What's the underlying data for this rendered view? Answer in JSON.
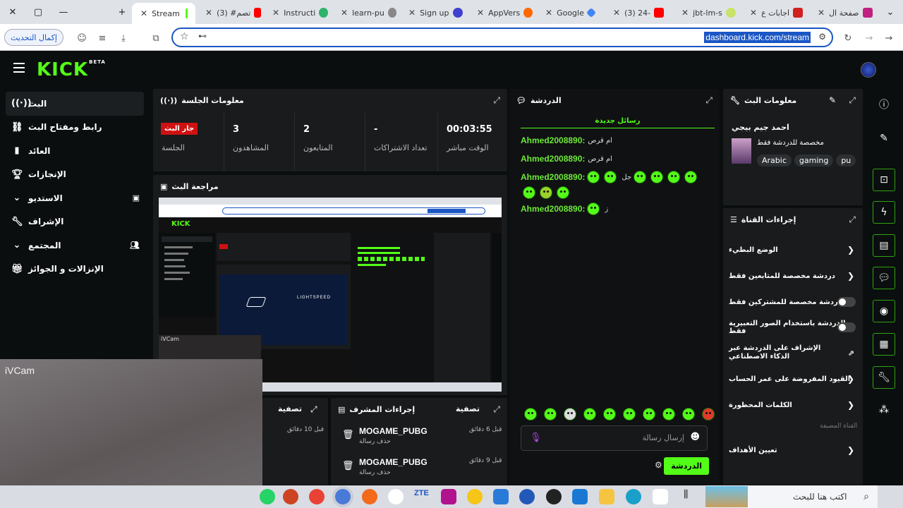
{
  "browser": {
    "window_controls": [
      "✕",
      "▢",
      "—"
    ],
    "tabs": [
      {
        "label": "Stream",
        "active": true,
        "color": "#53fc18"
      },
      {
        "label": "(3) #تصم",
        "color": "#ff0000"
      },
      {
        "label": "Instructi",
        "color": "#2fb36b"
      },
      {
        "label": "learn-pu",
        "color": "#888888"
      },
      {
        "label": "Sign up",
        "color": "#4040d0"
      },
      {
        "label": "AppVers",
        "color": "#ff6a00"
      },
      {
        "label": "Google",
        "color": "#4285f4"
      },
      {
        "label": "(3) 24-",
        "color": "#ff0000"
      },
      {
        "label": "jbt-lm-s",
        "color": "#c9e26a"
      },
      {
        "label": "اجابات ع",
        "color": "#d02020"
      },
      {
        "label": "صفحة ال",
        "color": "#c02080"
      }
    ],
    "url": "dashboard.kick.com/stream",
    "update_button": "إكمال التحديث"
  },
  "app": {
    "logo": "KICK",
    "logo_badge": "BETA",
    "sidebar": [
      {
        "label": "البث",
        "icon": "broadcast-icon",
        "active": true
      },
      {
        "label": "رابط ومفتاح البث",
        "icon": "link-icon"
      },
      {
        "label": "العائد",
        "icon": "chart-icon"
      },
      {
        "label": "الإنجازات",
        "icon": "trophy-icon"
      },
      {
        "label": "الاستديو",
        "icon": "studio-icon",
        "expandable": true
      },
      {
        "label": "الإشراف",
        "icon": "wrench-icon"
      },
      {
        "label": "المجتمع",
        "icon": "community-icon",
        "expandable": true
      },
      {
        "label": "الإنزالات و الجوائز",
        "icon": "gift-icon"
      }
    ],
    "session": {
      "title": "معلومات الجلسة",
      "live_badge": "جار البث",
      "stats": [
        {
          "value": "00:03:55",
          "label": "الوقت مباشر"
        },
        {
          "value": "-",
          "label": "تعداد الاشتراكات"
        },
        {
          "value": "2",
          "label": "المتابعون"
        },
        {
          "value": "3",
          "label": "المشاهدون"
        },
        {
          "value": "",
          "label": "الجلسة"
        }
      ]
    },
    "preview": {
      "title": "مراجعة البث"
    },
    "chat": {
      "title": "الدردشة",
      "new_messages": "رسائل جديدة",
      "messages": [
        {
          "user": "Ahmed2008890:",
          "text": "ام قرص",
          "emotes": 0
        },
        {
          "user": "Ahmed2008890:",
          "text": "ام قرص",
          "emotes": 0
        },
        {
          "user": "Ahmed2008890:",
          "text": "جل",
          "emotes": 9
        },
        {
          "user": "Ahmed2008890:",
          "text": "ز",
          "emotes": 1
        }
      ],
      "input_placeholder": "إرسال رسالة",
      "send_button": "الدردشة"
    },
    "stream_info": {
      "title": "معلومات البث",
      "stream_title": "احمد جيم بيجي",
      "subtitle": "مخصصة للدردشة فقط",
      "tags": [
        "Arabic",
        "gaming",
        "pu"
      ]
    },
    "channel_actions": {
      "title": "إجراءات القناة",
      "items": [
        {
          "label": "الوضع البطيء",
          "type": "chevron"
        },
        {
          "label": "دردشة مخصصة للمتابعين فقط",
          "type": "chevron"
        },
        {
          "label": "الدردشة مخصصة للمشتركين فقط",
          "type": "toggle"
        },
        {
          "label": "الدردشة باستخدام الصور التعبيرية فقط",
          "type": "toggle"
        },
        {
          "label": "الإشراف على الدردشة عبر الذكاء الاصطناعي",
          "type": "external"
        },
        {
          "label": "القيود المفروضة على عمر الحساب",
          "type": "chevron"
        },
        {
          "label": "الكلمات المحظورة",
          "type": "chevron"
        }
      ],
      "section_label": "القناة المضيفة",
      "set_goals": "تعيين الأهداف"
    },
    "mod_actions": {
      "title": "إجراءات المشرف",
      "filter": "تصفية",
      "rows": [
        {
          "user": "MOGAME_PUBG",
          "action": "حذف رسالة",
          "time": "قبل 6 دقائق"
        },
        {
          "user": "MOGAME_PUBG",
          "action": "حذف رسالة",
          "time": "قبل 9 دقائق"
        }
      ]
    },
    "left_filter": {
      "title": "تصفية",
      "time": "قبل 10 دقائق"
    }
  },
  "overlay": {
    "label": "iVCam",
    "mini_label": "iVCam"
  },
  "taskbar": {
    "search_placeholder": "اكتب هنا للبحث"
  }
}
